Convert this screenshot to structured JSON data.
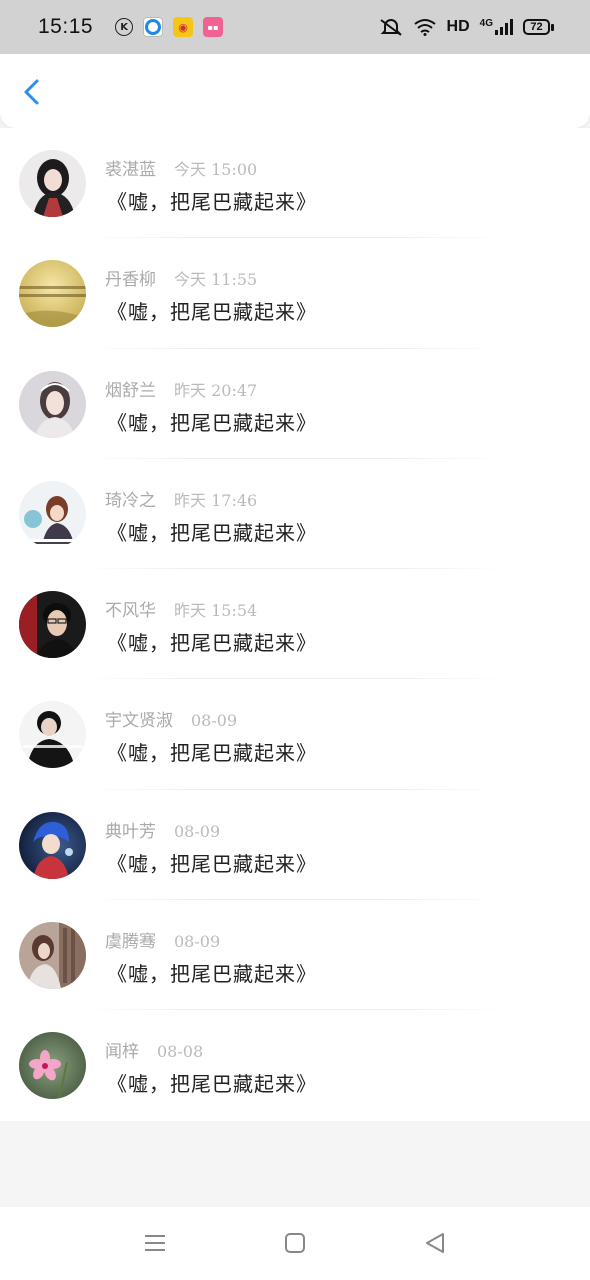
{
  "status_bar": {
    "time": "15:15",
    "network": "HD",
    "network_gen": "4G",
    "battery": "72",
    "app_icons": [
      "k-icon",
      "blue-circle-app-icon",
      "weibo-icon",
      "pink-app-icon"
    ]
  },
  "header": {
    "back_icon": "chevron-left-icon",
    "accent": "#2a8ff0"
  },
  "messages": [
    {
      "name": "裘湛蓝",
      "time": "今天 15:00",
      "text": "《嘘，把尾巴藏起来》"
    },
    {
      "name": "丹香柳",
      "time": "今天 11:55",
      "text": "《嘘，把尾巴藏起来》"
    },
    {
      "name": "烟舒兰",
      "time": "昨天 20:47",
      "text": "《嘘，把尾巴藏起来》"
    },
    {
      "name": "琦冷之",
      "time": "昨天 17:46",
      "text": "《嘘，把尾巴藏起来》"
    },
    {
      "name": "不风华",
      "time": "昨天 15:54",
      "text": "《嘘，把尾巴藏起来》"
    },
    {
      "name": "宇文贤淑",
      "time": "08-09",
      "text": "《嘘，把尾巴藏起来》"
    },
    {
      "name": "典叶芳",
      "time": "08-09",
      "text": "《嘘，把尾巴藏起来》"
    },
    {
      "name": "虞腾骞",
      "time": "08-09",
      "text": "《嘘，把尾巴藏起来》"
    },
    {
      "name": "闻梓",
      "time": "08-08",
      "text": "《嘘，把尾巴藏起来》"
    }
  ],
  "nav_bar": {
    "icons": [
      "menu-icon",
      "home-square-icon",
      "back-triangle-icon"
    ]
  }
}
